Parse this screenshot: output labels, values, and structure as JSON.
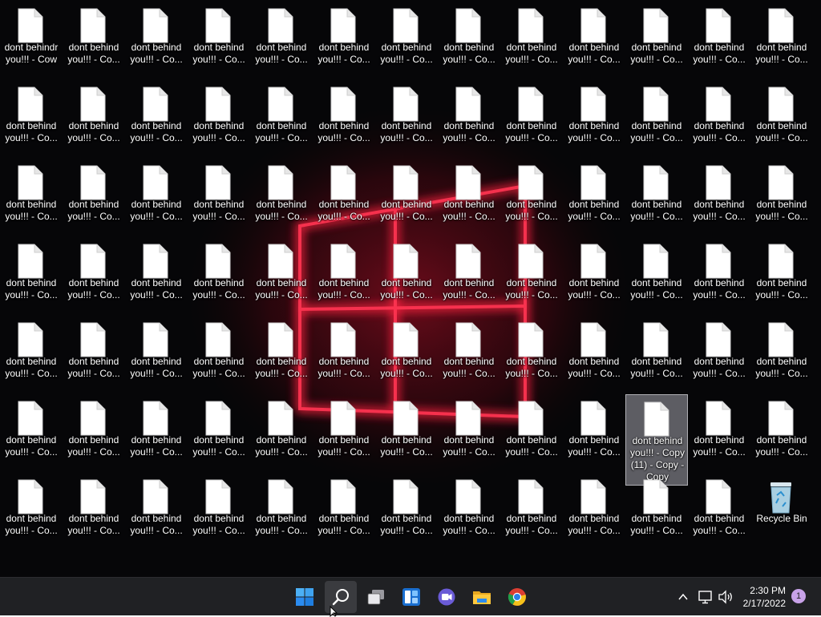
{
  "desktop": {
    "file_label": "dont behind\nyou!!! - Co...",
    "selected_label": "dont behind\nyou!!! - Copy\n(11) - Copy -\nCopy",
    "first_label": "dont behindr\nyou!!! - Cow",
    "recycle_label": "Recycle Bin",
    "columns": 13,
    "rows": 7
  },
  "taskbar": {
    "items": [
      {
        "name": "start-button",
        "icon": "windows-logo-icon"
      },
      {
        "name": "search-button",
        "icon": "search-icon"
      },
      {
        "name": "task-view-button",
        "icon": "task-view-icon"
      },
      {
        "name": "widgets-button",
        "icon": "widgets-icon"
      },
      {
        "name": "teams-chat-button",
        "icon": "chat-icon"
      },
      {
        "name": "file-explorer-button",
        "icon": "folder-icon"
      },
      {
        "name": "chrome-button",
        "icon": "chrome-icon"
      }
    ],
    "tray": {
      "time": "2:30 PM",
      "date": "2/17/2022",
      "notifications": "1"
    }
  },
  "colors": {
    "accent": "#ff2a45",
    "taskbar_bg": "#202124",
    "start_blue": "#2b8cf0"
  }
}
